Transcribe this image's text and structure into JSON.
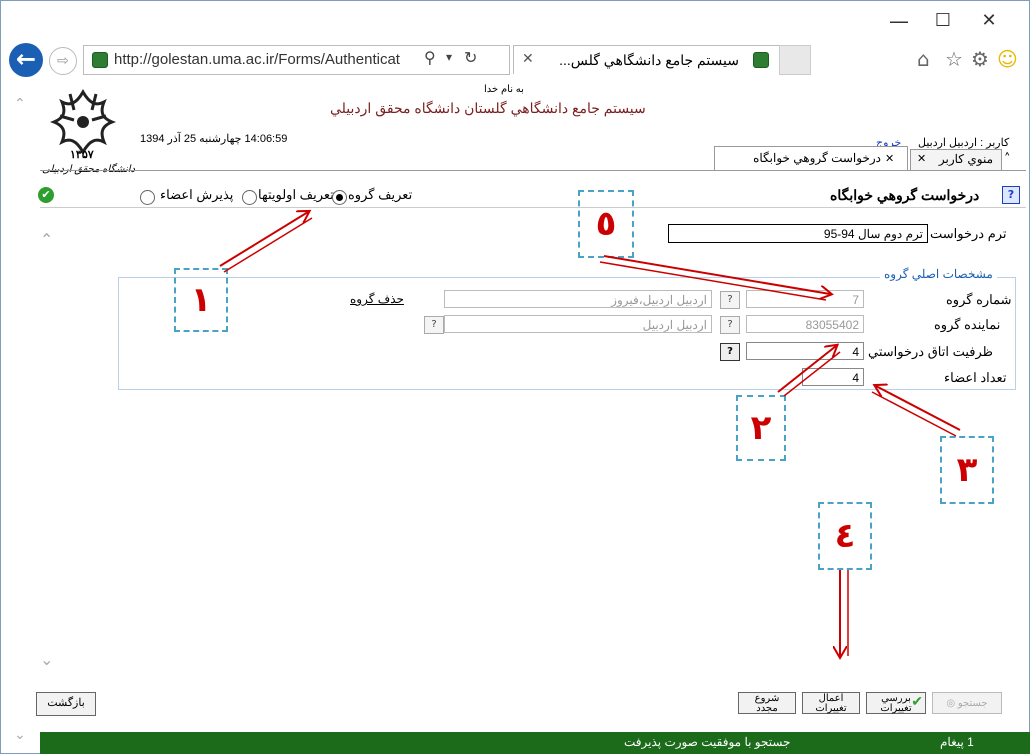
{
  "browser": {
    "url": "http://golestan.uma.ac.ir/Forms/Authenticat",
    "url_domain_bold": "uma.ac.ir",
    "tab_title": "سيستم جامع دانشگاهي گلس...",
    "window_buttons": {
      "minimize": "—",
      "maximize": "☐",
      "close": "✕"
    }
  },
  "header": {
    "bismillah": "به نام خدا",
    "system_title": "سيستم جامع دانشگاهي گلستان   دانشگاه محقق اردبيلي",
    "datetime": "14:06:59 چهارشنبه 25 آذر 1394",
    "user_label": "كاربر : اردبيل اردبيل",
    "logout": "خروج",
    "logo_year": "۱۳۵۷",
    "logo_caption": "دانشگاه محقق اردبیلی"
  },
  "tabs": [
    {
      "label": "منوي كاربر",
      "close": "✕"
    },
    {
      "label": "درخواست گروهي خوابگاه",
      "close": "✕"
    }
  ],
  "page": {
    "title": "درخواست گروهي خوابگاه",
    "term_label": "ترم درخواست",
    "term_value": "ترم دوم سال 94-95"
  },
  "radios": [
    {
      "label": "تعريف گروه",
      "checked": true
    },
    {
      "label": "تعريف اولويتها",
      "checked": false
    },
    {
      "label": "پذيرش اعضاء",
      "checked": false
    }
  ],
  "group_section": {
    "legend": "مشخصات اصلي گروه",
    "group_number_label": "شماره گروه",
    "group_number_value": "7",
    "group_number_name": "اردبيل  اردبيل،فيروز",
    "delete_group": "حذف گروه",
    "rep_label": "نماينده گروه",
    "rep_value": "83055402",
    "rep_name": "اردبيل  اردبيل",
    "capacity_label": "ظرفيت اتاق درخواستي",
    "capacity_value": "4",
    "members_label": "تعداد اعضاء",
    "members_value": "4",
    "qmark": "?"
  },
  "annotations": [
    "١",
    "٢",
    "٣",
    "٤",
    "٥"
  ],
  "toolbar": {
    "search": "جستجو",
    "review_line1": "بررسي",
    "review_line2": "تغييرات",
    "apply_line1": "اعمال",
    "apply_line2": "تغييرات",
    "restart_line1": "شروع",
    "restart_line2": "مجدد",
    "back": "بازگشت"
  },
  "status": {
    "message": "جستجو با موفقيت صورت پذيرفت",
    "count": "1 پيغام"
  },
  "colors": {
    "status_bg": "#1b6b1b",
    "annotation_border": "#4aa3c7",
    "annotation_digit": "#cc0000",
    "arrow": "#cc0000",
    "header_text": "#7a1f1f"
  }
}
